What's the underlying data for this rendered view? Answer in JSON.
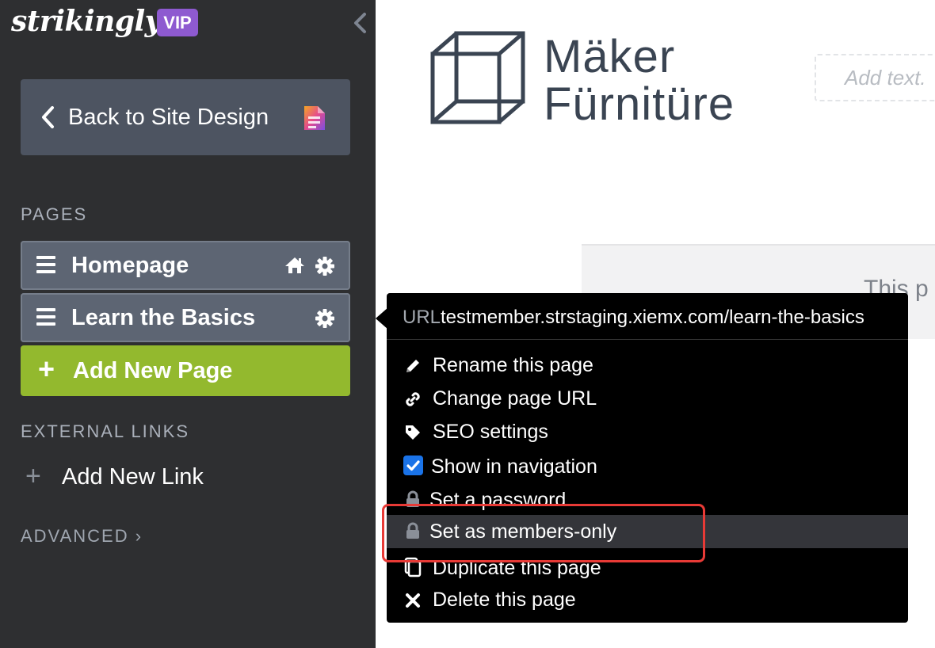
{
  "sidebar": {
    "brand": "strikingly",
    "badge": "VIP",
    "back_button": "Back to Site Design",
    "pages_heading": "PAGES",
    "pages": [
      {
        "label": "Homepage",
        "is_home": true
      },
      {
        "label": "Learn the Basics",
        "is_home": false
      }
    ],
    "add_page": "Add New Page",
    "external_links_heading": "EXTERNAL LINKS",
    "add_link": "Add New Link",
    "advanced": "ADVANCED ›"
  },
  "canvas": {
    "logo_line1": "Mäker",
    "logo_line2": "Fürnitüre",
    "add_text_placeholder": "Add text.",
    "partial_text": "This p"
  },
  "popup": {
    "url_key": "URL",
    "url_value": "testmember.strstaging.xiemx.com/learn-the-basics",
    "items": [
      {
        "label": "Rename this page",
        "icon": "pencil-icon"
      },
      {
        "label": "Change page URL",
        "icon": "link-icon"
      },
      {
        "label": "SEO settings",
        "icon": "tag-icon"
      },
      {
        "label": "Show in navigation",
        "icon": "checkbox-icon",
        "checked": true
      },
      {
        "label": "Set a password",
        "icon": "lock-icon"
      },
      {
        "label": "Set as members-only",
        "icon": "lock-icon",
        "highlighted": true
      },
      {
        "label": "Duplicate this page",
        "icon": "copy-icon"
      },
      {
        "label": "Delete this page",
        "icon": "close-icon"
      }
    ]
  },
  "colors": {
    "sidebar_bg": "#2e2f31",
    "page_item_bg": "#5d6573",
    "add_page_green": "#93b92e",
    "vip_purple": "#8e5ad0",
    "checkbox_blue": "#1a73e8",
    "highlight_red": "#e83a36"
  }
}
